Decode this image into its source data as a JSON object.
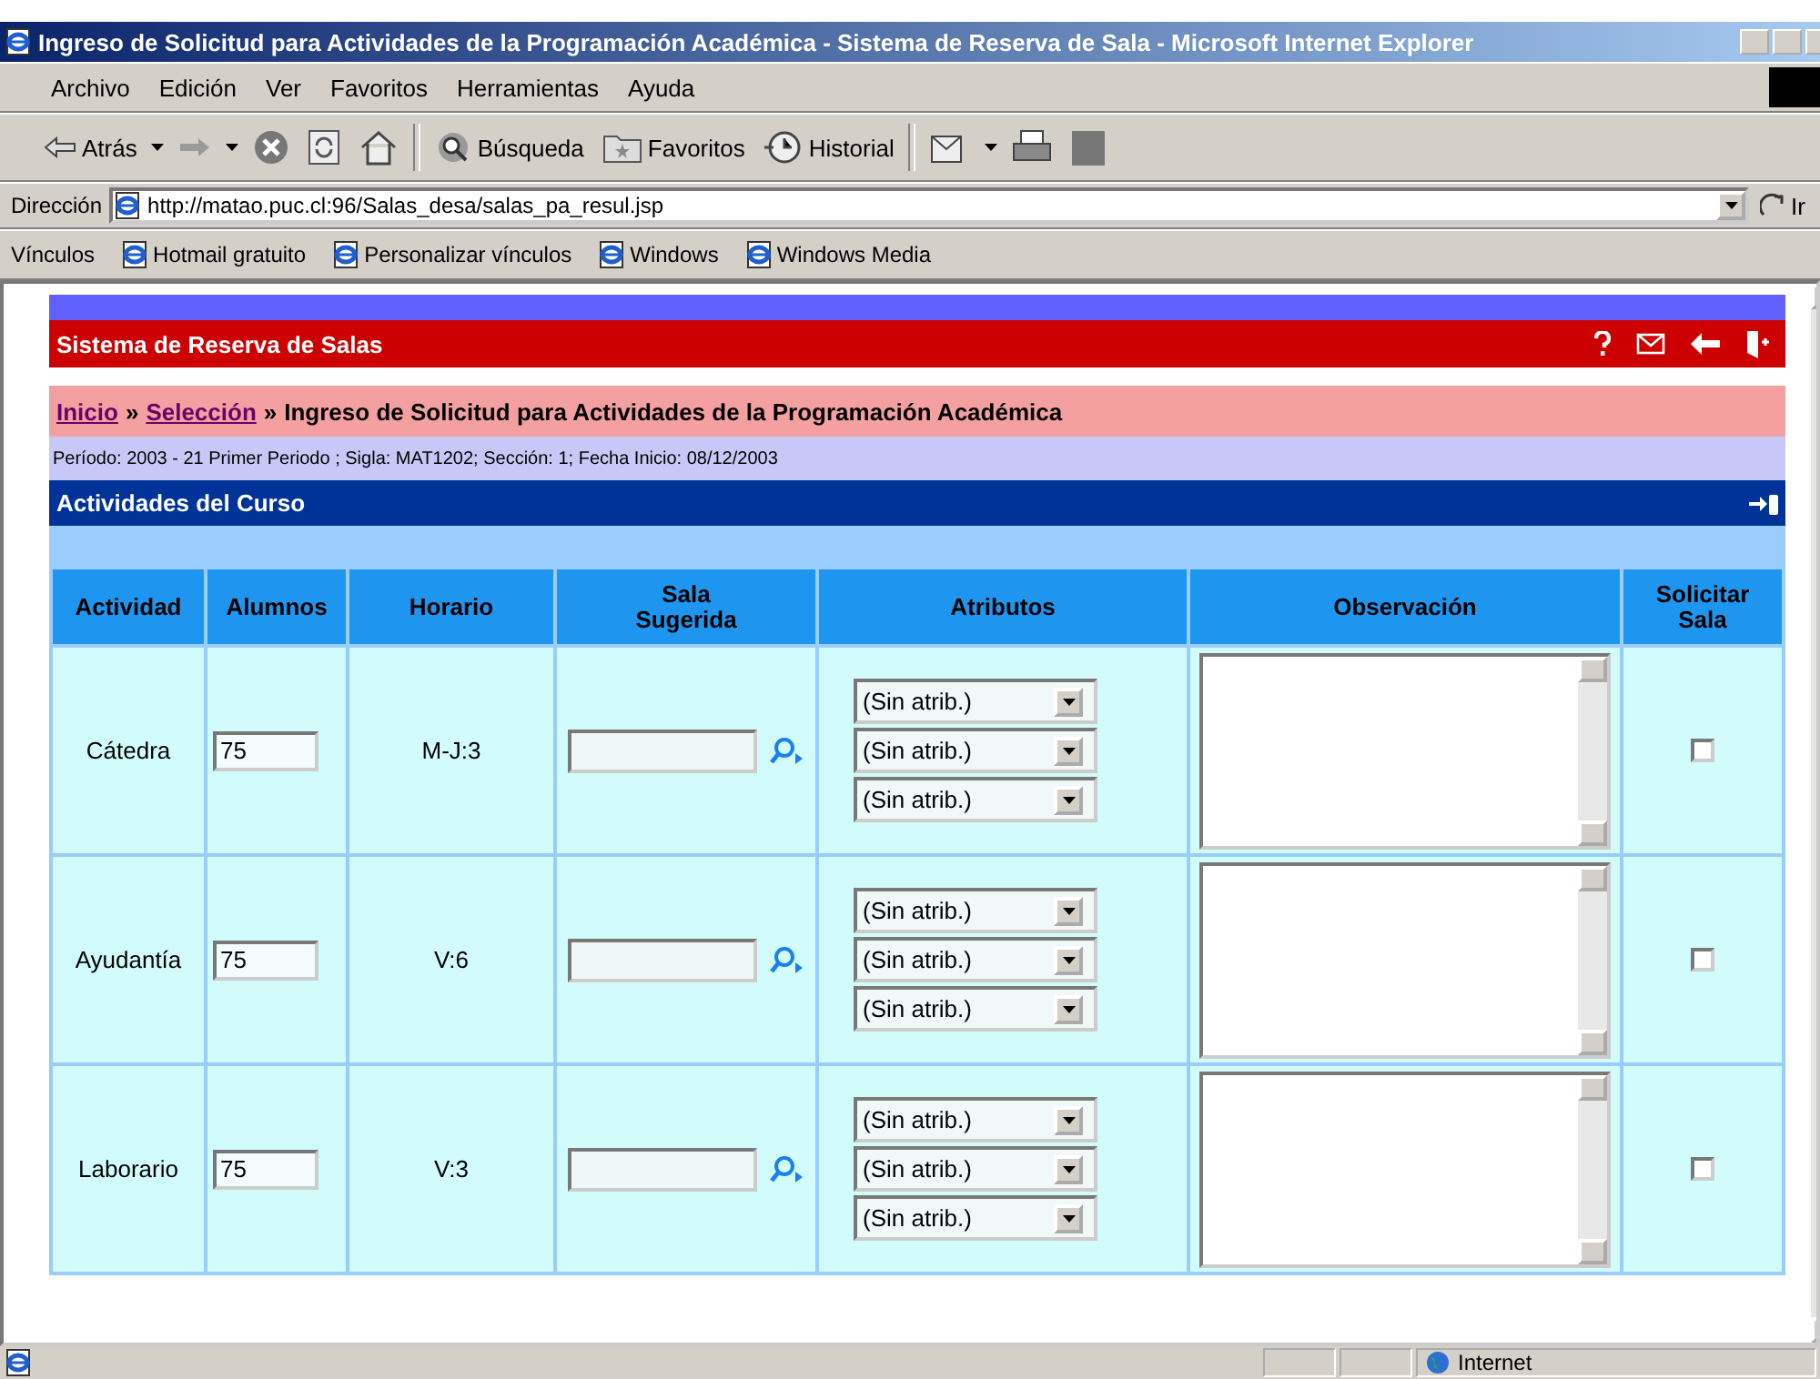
{
  "window": {
    "title": "Ingreso de Solicitud para Actividades de la Programación Académica - Sistema de Reserva de Sala - Microsoft Internet Explorer"
  },
  "menu": [
    "Archivo",
    "Edición",
    "Ver",
    "Favoritos",
    "Herramientas",
    "Ayuda"
  ],
  "toolbar": {
    "back": "Atrás",
    "search": "Búsqueda",
    "favorites": "Favoritos",
    "history": "Historial"
  },
  "address": {
    "label": "Dirección",
    "value": "http://matao.puc.cl:96/Salas_desa/salas_pa_resul.jsp",
    "go": "Ir"
  },
  "links": {
    "label": "Vínculos",
    "items": [
      "Hotmail gratuito",
      "Personalizar vínculos",
      "Windows",
      "Windows Media"
    ]
  },
  "app_header": {
    "title": "Sistema de Reserva de Salas"
  },
  "breadcrumb": [
    {
      "label": "Inicio",
      "kind": "link"
    },
    {
      "label": "»",
      "kind": "sep"
    },
    {
      "label": "Selección",
      "kind": "link"
    },
    {
      "label": "»",
      "kind": "sep"
    },
    {
      "label": "Ingreso de Solicitud para Actividades de la Programación Académica",
      "kind": "current"
    }
  ],
  "info": "Período: 2003 - 21 Primer Periodo ; Sigla: MAT1202; Sección: 1; Fecha Inicio: 08/12/2003",
  "section": {
    "title": "Actividades del Curso"
  },
  "table": {
    "columns": [
      "Actividad",
      "Alumnos",
      "Horario",
      "Sala Sugerida",
      "Atributos",
      "Observación",
      "Solicitar Sala"
    ],
    "rows": [
      {
        "activity": "Cátedra",
        "students": "75",
        "schedule": "M-J:3",
        "attributes": [
          "(Sin atrib.)",
          "(Sin atrib.)",
          "(Sin atrib.)"
        ],
        "request_checked": false
      },
      {
        "activity": "Ayudantía",
        "students": "75",
        "schedule": "V:6",
        "attributes": [
          "(Sin atrib.)",
          "(Sin atrib.)",
          "(Sin atrib.)"
        ],
        "request_checked": false
      },
      {
        "activity": "Laborario",
        "students": "75",
        "schedule": "V:3",
        "attributes": [
          "(Sin atrib.)",
          "(Sin atrib.)",
          "(Sin atrib.)"
        ],
        "request_checked": false
      }
    ]
  },
  "status_bar": {
    "zone": "Internet"
  }
}
